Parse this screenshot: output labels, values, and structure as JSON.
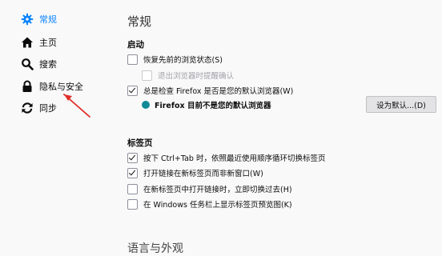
{
  "sidebar": {
    "items": [
      {
        "label": "常规",
        "icon": "gear-icon",
        "active": true
      },
      {
        "label": "主页",
        "icon": "home-icon"
      },
      {
        "label": "搜索",
        "icon": "search-icon"
      },
      {
        "label": "隐私与安全",
        "icon": "lock-icon"
      },
      {
        "label": "同步",
        "icon": "sync-icon"
      }
    ]
  },
  "main": {
    "title": "常规",
    "startup": {
      "heading": "启动",
      "restore_session": "恢复先前的浏览状态(S)",
      "warn_on_quit": "退出浏览器时提醒确认",
      "check_default": "总是检查 Firefox 是否是您的默认浏览器(W)",
      "status": "Firefox 目前不是您的默认浏览器",
      "set_default_button": "设为默认...(D)"
    },
    "tabs": {
      "heading": "标签页",
      "ctrl_tab": "按下 Ctrl+Tab 时，依照最近使用顺序循环切换标签页",
      "open_links_in_tabs": "打开链接在新标签页而非新窗口(W)",
      "switch_to_new_tab": "在新标签页中打开链接时，立即切换过去(H)",
      "taskbar_previews": "在 Windows 任务栏上显示标签页预览图(K)"
    },
    "next_section": "语言与外观"
  },
  "colors": {
    "accent": "#0a84ff",
    "annotation_arrow": "#e0302a"
  }
}
